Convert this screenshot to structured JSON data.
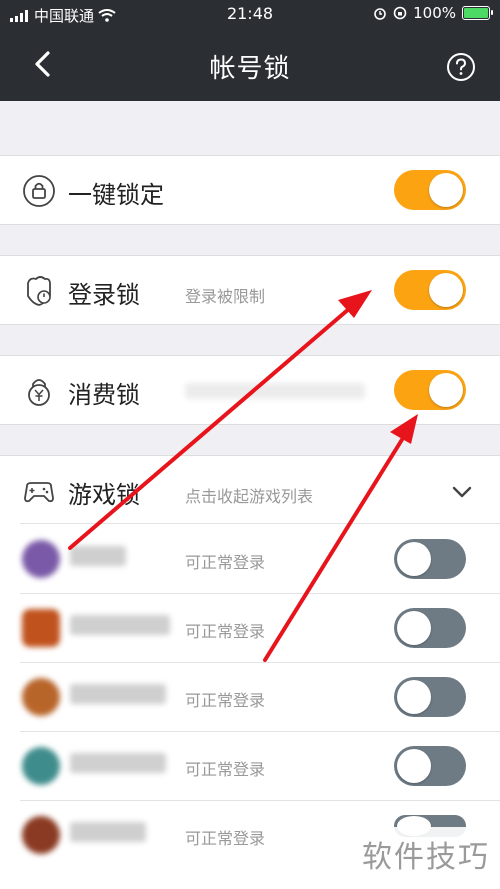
{
  "status_bar": {
    "carrier": "中国联通",
    "time": "21:48",
    "battery": "100%"
  },
  "nav": {
    "title": "帐号锁",
    "back_icon": "chevron-left-icon",
    "help_icon": "question-circle-icon"
  },
  "locks": {
    "one_key": {
      "label": "一键锁定",
      "enabled": true
    },
    "login": {
      "label": "登录锁",
      "desc": "登录被限制",
      "enabled": true
    },
    "payment": {
      "label": "消费锁",
      "desc": "",
      "enabled": true
    },
    "game": {
      "label": "游戏锁",
      "desc": "点击收起游戏列表"
    }
  },
  "games": [
    {
      "status": "可正常登录",
      "enabled": false
    },
    {
      "status": "可正常登录",
      "enabled": false
    },
    {
      "status": "可正常登录",
      "enabled": false
    },
    {
      "status": "可正常登录",
      "enabled": false
    },
    {
      "status": "可正常登录",
      "enabled": false
    }
  ],
  "watermark": "软件技巧",
  "colors": {
    "accent": "#fca312",
    "toggle_off": "#6e7b85",
    "header_bg": "#2b2f33",
    "arrow": "#e8141b"
  }
}
